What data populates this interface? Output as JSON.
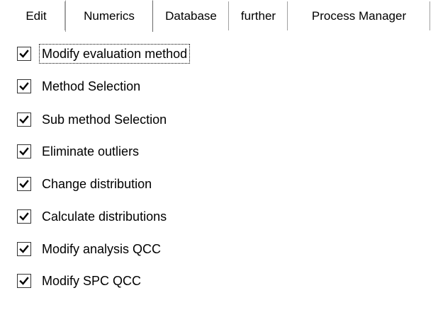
{
  "tabs": [
    {
      "label": "Edit",
      "active": false
    },
    {
      "label": "Numerics",
      "active": true
    },
    {
      "label": "Database",
      "active": false
    },
    {
      "label": "further",
      "active": false
    },
    {
      "label": "Process Manager",
      "active": false
    }
  ],
  "options": [
    {
      "label": "Modify evaluation method",
      "checked": true,
      "focused": true
    },
    {
      "label": "Method Selection",
      "checked": true,
      "focused": false
    },
    {
      "label": "Sub method Selection",
      "checked": true,
      "focused": false
    },
    {
      "label": "Eliminate outliers",
      "checked": true,
      "focused": false
    },
    {
      "label": "Change distribution",
      "checked": true,
      "focused": false
    },
    {
      "label": "Calculate distributions",
      "checked": true,
      "focused": false
    },
    {
      "label": "Modify analysis QCC",
      "checked": true,
      "focused": false
    },
    {
      "label": "Modify SPC QCC",
      "checked": true,
      "focused": false
    }
  ],
  "icons": {
    "checkmark": "checkmark-icon"
  }
}
